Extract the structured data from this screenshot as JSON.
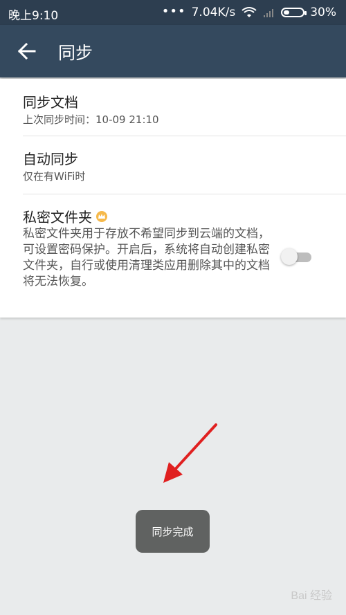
{
  "status_bar": {
    "time": "晚上9:10",
    "net_speed": "7.04K/s",
    "battery": "30%",
    "icons": [
      "more-dots-icon",
      "wifi-icon",
      "signal-icon",
      "battery-icon"
    ]
  },
  "app_bar": {
    "title": "同步",
    "back_icon": "arrow-left-icon"
  },
  "settings": [
    {
      "title": "同步文档",
      "subtitle": "上次同步时间：10-09 21:10"
    },
    {
      "title": "自动同步",
      "subtitle": "仅在有WiFi时"
    },
    {
      "title": "私密文件夹",
      "badge_icon": "crown-icon",
      "description": "私密文件夹用于存放不希望同步到云端的文档，可设置密码保护。开启后，系统将自动创建私密文件夹，自行或使用清理类应用删除其中的文档将无法恢复。",
      "toggle_on": false
    }
  ],
  "toast": {
    "text": "同步完成"
  },
  "annotation": {
    "icon": "red-arrow-icon",
    "color": "#e02020"
  },
  "watermark": {
    "text": "Bai 经验"
  },
  "colors": {
    "status_bar": "#2d3e50",
    "app_bar": "#34495e",
    "background": "#e9ebec",
    "toast": "#606261",
    "crown": "#f6b94a"
  }
}
